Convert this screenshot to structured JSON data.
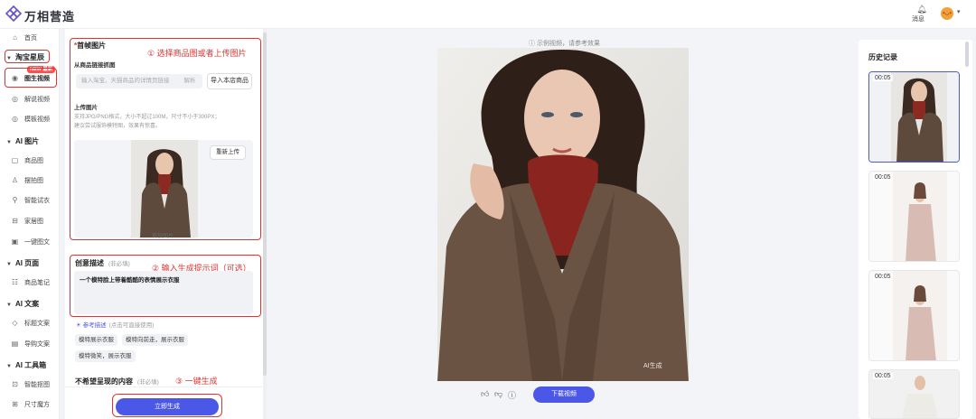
{
  "app": {
    "name": "万相营造"
  },
  "header": {
    "messages_label": "消息"
  },
  "sidebar": {
    "home": "首页",
    "groups": [
      {
        "label": "淘宝星辰"
      },
      {
        "label": "AI 图片"
      },
      {
        "label": "AI 页面"
      },
      {
        "label": "AI 文案"
      },
      {
        "label": "AI 工具箱"
      }
    ],
    "new_badge": "NEW 最新",
    "items": [
      "图生视频",
      "解说视频",
      "模板视频",
      "商品图",
      "摆拍图",
      "智能试衣",
      "家居图",
      "一键图文",
      "商品笔记",
      "标题文案",
      "导购文案",
      "智能抠图",
      "尺寸魔方"
    ]
  },
  "form": {
    "first_frame_label": "首帧图片",
    "required_mark": "*",
    "from_link_label": "从商品链接抓图",
    "link_placeholder": "输入淘宝、天猫商品的详情页链接",
    "parse_label": "解析",
    "import_button": "导入本店商品",
    "upload_label": "上传图片",
    "upload_hint_1": "支持JPG/PNG格式，大小不超过100M，尺寸不小于300PX；",
    "upload_hint_2": "建议尝试服饰模特图，效果有惊喜。",
    "reupload_button": "重新上传",
    "image_caption": "首帧图片",
    "creative_label": "创意描述",
    "optional": "(非必填)",
    "creative_value": "一个模特脸上带着酷酷的表情展示衣服",
    "reference_label": "参考描述",
    "reference_hint": "(点击可直接使用)",
    "reference_tags": [
      "模特展示衣服",
      "模特向前走，展示衣服",
      "模特微笑，展示衣服"
    ],
    "negative_label": "不希望呈现的内容",
    "negative_optional": "(非必填)",
    "generate_button": "立即生成"
  },
  "annotations": {
    "step1": "① 选择商品图或者上传图片",
    "step2": "② 输入生成提示词（可选）",
    "step3": "③ 一键生成"
  },
  "preview": {
    "note": "示例视频，请参考效果",
    "watermark": "AI生成",
    "download_button": "下载视频"
  },
  "history": {
    "title": "历史记录",
    "items": [
      {
        "duration": "00:05"
      },
      {
        "duration": "00:05"
      },
      {
        "duration": "00:05"
      },
      {
        "duration": "00:05"
      }
    ]
  },
  "colors": {
    "accent": "#4b57e6",
    "annotation": "#e03232",
    "badge": "#ff4d4f"
  }
}
